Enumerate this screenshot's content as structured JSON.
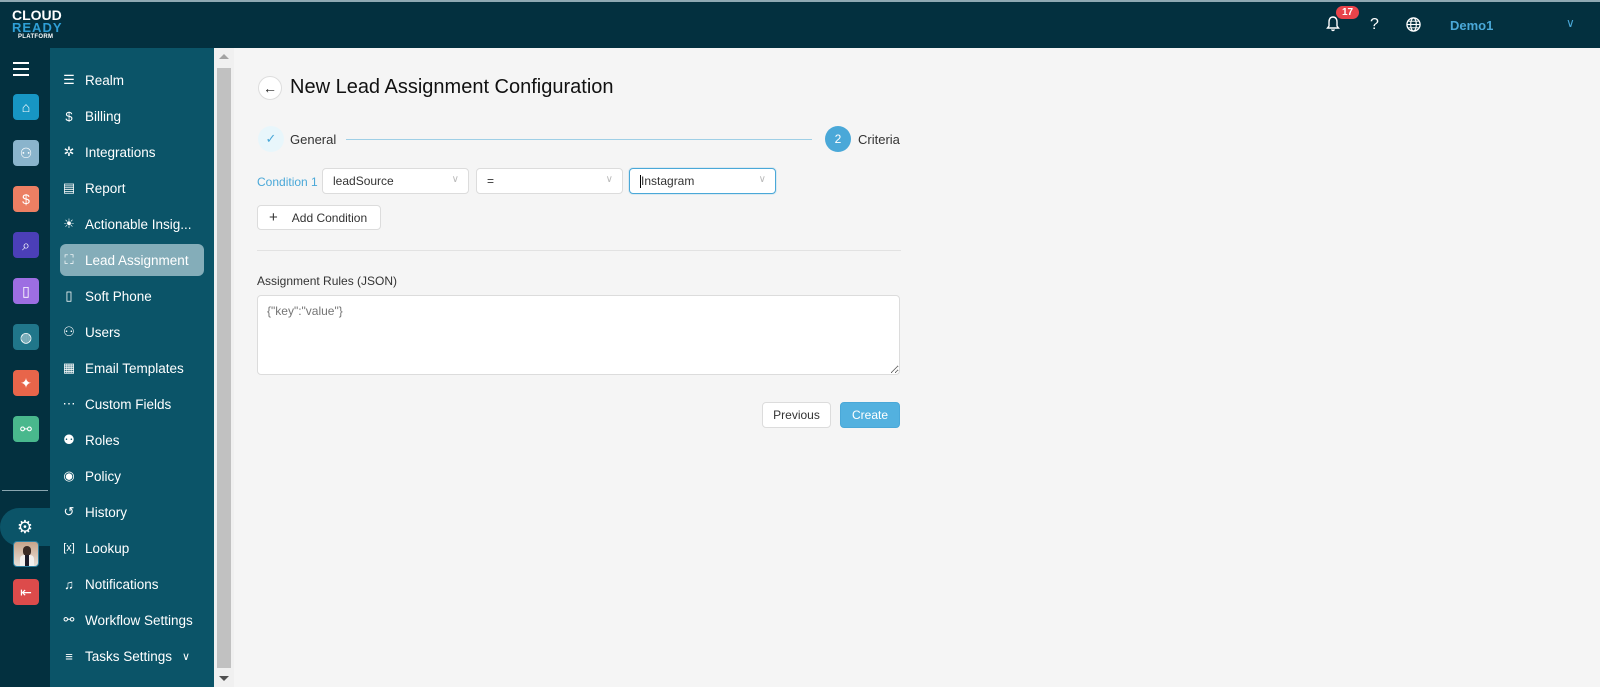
{
  "header": {
    "logo": {
      "line1": "CLOUD",
      "line2": "READY",
      "line3": "PLATFORM"
    },
    "notifications_count": "17",
    "help_label": "?",
    "user_name": "Demo1"
  },
  "rail": {
    "items": [
      {
        "name": "realty-app",
        "color": "#1796c4"
      },
      {
        "name": "team-app",
        "color": "#8ab4cc"
      },
      {
        "name": "finance-app",
        "color": "#ec7f63"
      },
      {
        "name": "property-search-app",
        "color": "#4b3fb8"
      },
      {
        "name": "mobile-app",
        "color": "#9d6ee2"
      },
      {
        "name": "web-app",
        "color": "#20768a"
      },
      {
        "name": "marketing-app",
        "color": "#e8654a"
      },
      {
        "name": "integration-app",
        "color": "#49b88d"
      }
    ],
    "logout_color": "#dc4b4b"
  },
  "sidebar": {
    "items": [
      {
        "label": "Realm",
        "icon": "realm-icon",
        "glyph": "☰"
      },
      {
        "label": "Billing",
        "icon": "billing-icon",
        "glyph": "$"
      },
      {
        "label": "Integrations",
        "icon": "integrations-icon",
        "glyph": "✲"
      },
      {
        "label": "Report",
        "icon": "report-icon",
        "glyph": "▤"
      },
      {
        "label": "Actionable Insig...",
        "icon": "lightbulb-icon",
        "glyph": "☀"
      },
      {
        "label": "Lead Assignment",
        "icon": "lead-assignment-icon",
        "glyph": "⛶",
        "active": true
      },
      {
        "label": "Soft Phone",
        "icon": "soft-phone-icon",
        "glyph": "▯"
      },
      {
        "label": "Users",
        "icon": "user-icon",
        "glyph": "⚇"
      },
      {
        "label": "Email Templates",
        "icon": "email-templates-icon",
        "glyph": "▦"
      },
      {
        "label": "Custom Fields",
        "icon": "custom-fields-icon",
        "glyph": "⋯"
      },
      {
        "label": "Roles",
        "icon": "roles-icon",
        "glyph": "⚉"
      },
      {
        "label": "Policy",
        "icon": "policy-icon",
        "glyph": "◉"
      },
      {
        "label": "History",
        "icon": "history-icon",
        "glyph": "↺"
      },
      {
        "label": "Lookup",
        "icon": "lookup-icon",
        "glyph": "[x]"
      },
      {
        "label": "Notifications",
        "icon": "notifications-icon",
        "glyph": "♫"
      },
      {
        "label": "Workflow Settings",
        "icon": "workflow-icon",
        "glyph": "⚯"
      },
      {
        "label": "Tasks Settings",
        "icon": "tasks-icon",
        "glyph": "≡"
      }
    ]
  },
  "main": {
    "title": "New Lead Assignment Configuration",
    "steps": [
      {
        "label": "General",
        "state": "done",
        "marker": "✓"
      },
      {
        "label": "Criteria",
        "state": "active",
        "marker": "2"
      }
    ],
    "conditions": [
      {
        "label": "Condition 1",
        "field": "leadSource",
        "operator": "=",
        "value": "Instagram"
      }
    ],
    "add_condition_label": "Add Condition",
    "rules_label": "Assignment Rules (JSON)",
    "rules_placeholder": "{\"key\":\"value\"}",
    "rules_value": "",
    "previous_label": "Previous",
    "create_label": "Create"
  }
}
